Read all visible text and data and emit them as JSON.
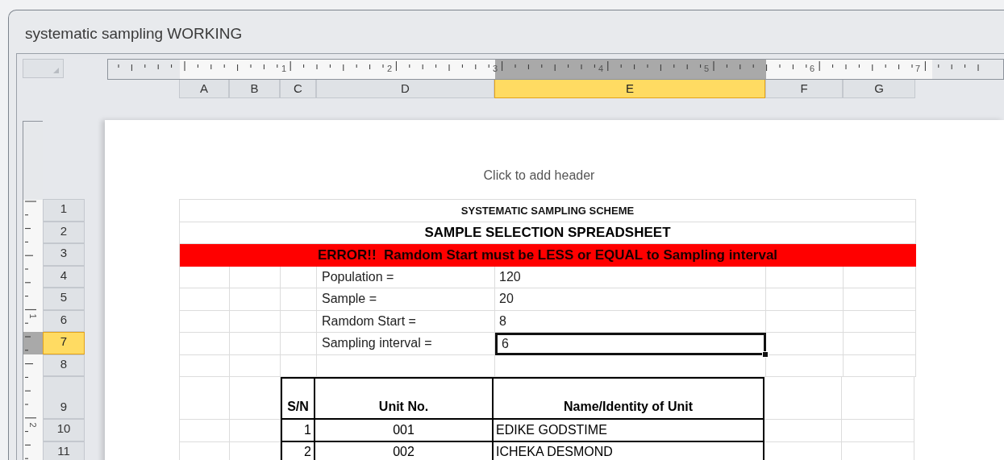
{
  "window": {
    "title": "systematic sampling WORKING"
  },
  "ruler": {
    "horizontal_labels": [
      "1",
      "2",
      "3",
      "4",
      "5",
      "6",
      "7"
    ],
    "vertical_labels": [
      "1",
      "2"
    ]
  },
  "columns": [
    {
      "label": "A",
      "selected": false
    },
    {
      "label": "B",
      "selected": false
    },
    {
      "label": "C",
      "selected": false
    },
    {
      "label": "D",
      "selected": false
    },
    {
      "label": "E",
      "selected": true
    },
    {
      "label": "F",
      "selected": false
    },
    {
      "label": "G",
      "selected": false
    }
  ],
  "rows": [
    {
      "label": "1",
      "selected": false
    },
    {
      "label": "2",
      "selected": false
    },
    {
      "label": "3",
      "selected": false
    },
    {
      "label": "4",
      "selected": false
    },
    {
      "label": "5",
      "selected": false
    },
    {
      "label": "6",
      "selected": false
    },
    {
      "label": "7",
      "selected": true
    },
    {
      "label": "8",
      "selected": false
    },
    {
      "label": "9",
      "selected": false
    },
    {
      "label": "10",
      "selected": false
    },
    {
      "label": "11",
      "selected": false
    }
  ],
  "page": {
    "header_placeholder": "Click to add header"
  },
  "sheet": [
    {
      "kind": "title",
      "text": "SYSTEMATIC SAMPLING SCHEME"
    },
    {
      "kind": "subtitle",
      "text": "SAMPLE SELECTION SPREADSHEET"
    },
    {
      "kind": "error",
      "text": "ERROR!!  Ramdom Start must be LESS or EQUAL to Sampling interval"
    },
    {
      "kind": "field",
      "label": "Population =",
      "value": "120",
      "selected": false
    },
    {
      "kind": "field",
      "label": "Sample  =",
      "value": "20",
      "selected": false
    },
    {
      "kind": "field",
      "label": "Ramdom Start =",
      "value": "8",
      "selected": false
    },
    {
      "kind": "field",
      "label": "Sampling interval =",
      "value": "6",
      "selected": true
    },
    {
      "kind": "blank"
    },
    {
      "kind": "table_header",
      "cells": [
        "S/N",
        "Unit No.",
        "Name/Identity of Unit"
      ]
    },
    {
      "kind": "table_row",
      "cells": [
        "1",
        "001",
        "EDIKE GODSTIME"
      ]
    },
    {
      "kind": "table_row",
      "cells": [
        "2",
        "002",
        "ICHEKA DESMOND"
      ]
    }
  ]
}
